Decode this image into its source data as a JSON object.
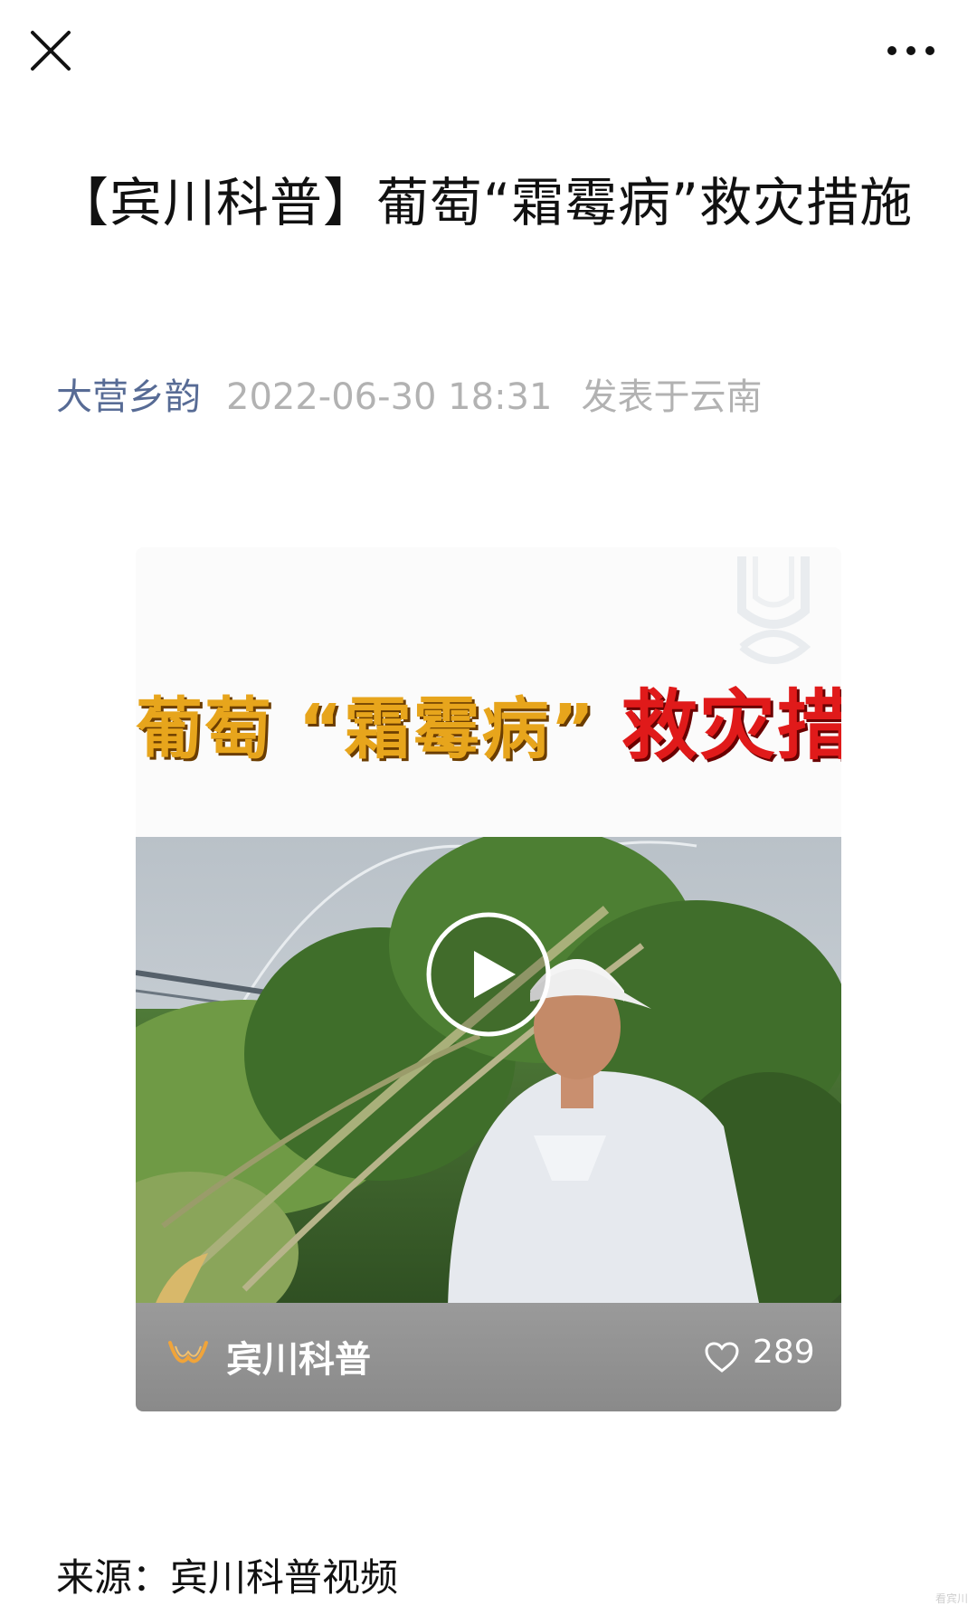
{
  "article": {
    "title": "【宾川科普】葡萄“霜霉病”救灾措施",
    "author": "大营乡韵",
    "date": "2022-06-30 18:31",
    "location": "发表于云南",
    "source": "来源：宾川科普视频"
  },
  "video": {
    "cover_title_gold_1": "葡萄",
    "cover_title_gold_2": "“霜霉病”",
    "cover_title_red": "救灾措施",
    "channel": "宾川科普",
    "likes": "289"
  },
  "watermark": "看宾川",
  "icons": {
    "close": "close-icon",
    "more": "more-icon",
    "play": "play-icon",
    "channel": "channel-logo-icon",
    "like": "heart-icon"
  },
  "colors": {
    "author_link": "#576b95",
    "meta_gray": "#b2b2b2",
    "cover_gold": "#e7a51c",
    "cover_red": "#e01a1a",
    "channel_orange": "#f0a43a"
  }
}
